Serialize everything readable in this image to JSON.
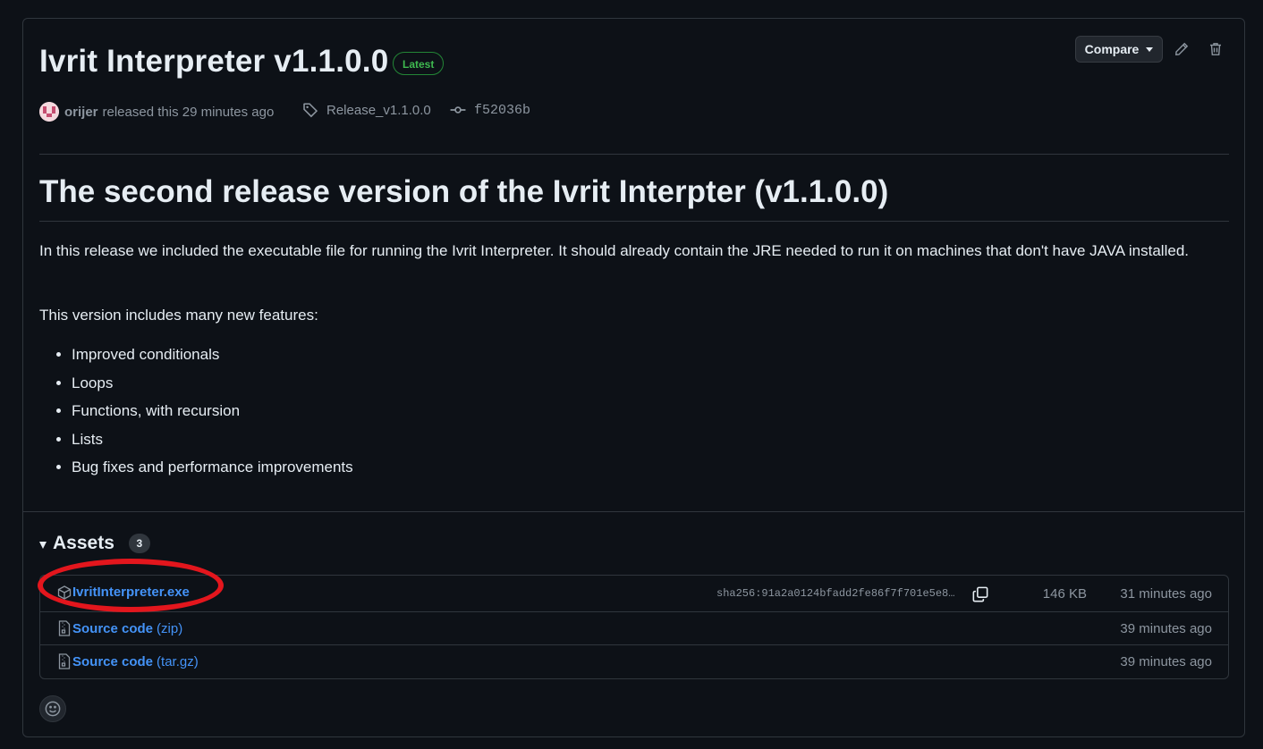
{
  "release": {
    "title": "Ivrit Interpreter v1.1.0.0",
    "badge": "Latest",
    "compare_label": "Compare",
    "author": "orijer",
    "released_text": "released this 29 minutes ago",
    "tag": "Release_v1.1.0.0",
    "commit": "f52036b"
  },
  "body": {
    "heading": "The second release version of the Ivrit Interpter (v1.1.0.0)",
    "intro": "In this release we included the executable file for running the Ivrit Interpreter. It should already contain the JRE needed to run it on machines that don't have JAVA installed.",
    "features_intro": "This version includes many new features:",
    "features": [
      "Improved conditionals",
      "Loops",
      "Functions, with recursion",
      "Lists",
      "Bug fixes and performance improvements"
    ]
  },
  "assets": {
    "title": "Assets",
    "count": "3",
    "items": [
      {
        "name": "IvritInterpreter.exe",
        "suffix": "",
        "sha": "sha256:91a2a0124bfadd2fe86f7f701e5e8…",
        "size": "146 KB",
        "time": "31 minutes ago",
        "icon": "package-icon"
      },
      {
        "name": "Source code",
        "suffix": "(zip)",
        "sha": "",
        "size": "",
        "time": "39 minutes ago",
        "icon": "file-zip-icon"
      },
      {
        "name": "Source code",
        "suffix": "(tar.gz)",
        "sha": "",
        "size": "",
        "time": "39 minutes ago",
        "icon": "file-zip-icon"
      }
    ]
  },
  "colors": {
    "background": "#0d1117",
    "link": "#4493f8",
    "latest_badge": "#3fb950",
    "annotation": "#e3161d"
  }
}
